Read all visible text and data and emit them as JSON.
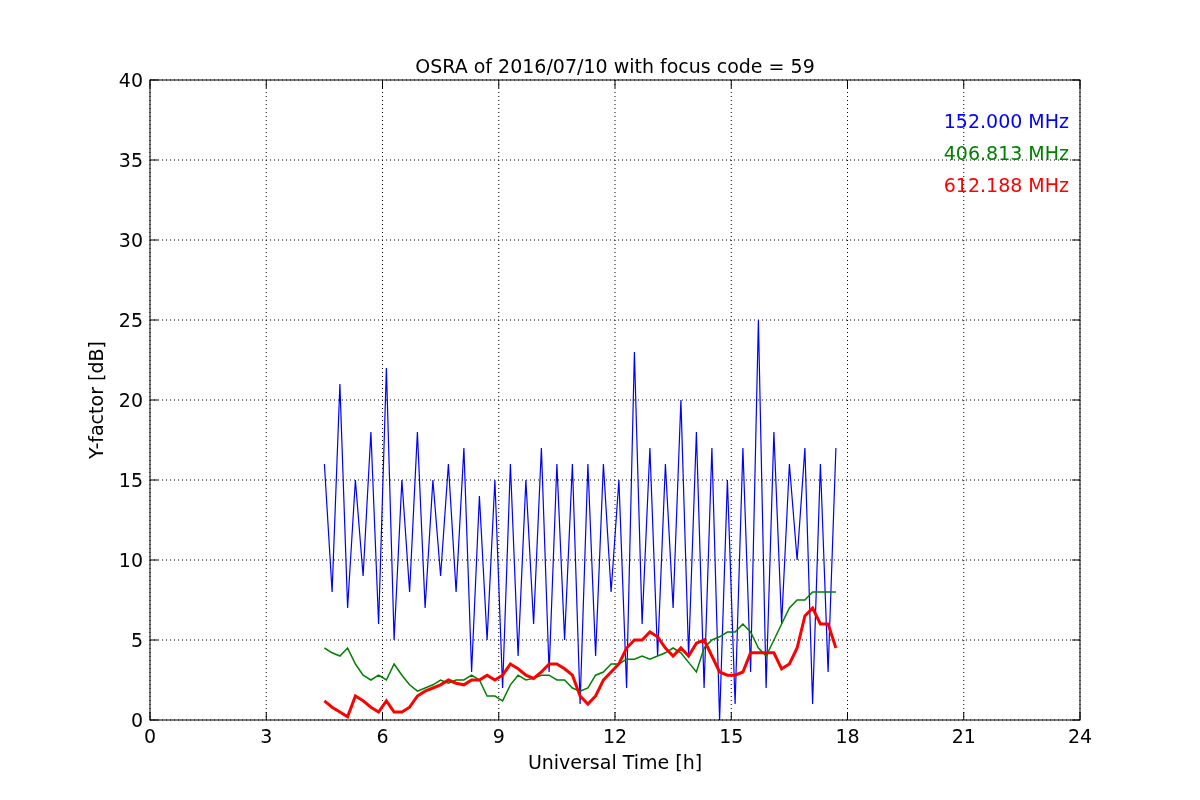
{
  "chart_data": {
    "type": "line",
    "title": "OSRA of 2016/07/10 with focus code = 59",
    "xlabel": "Universal Time [h]",
    "ylabel": "Y-factor [dB]",
    "x": [
      4.5,
      4.7,
      4.9,
      5.1,
      5.3,
      5.5,
      5.7,
      5.9,
      6.1,
      6.3,
      6.5,
      6.7,
      6.9,
      7.1,
      7.3,
      7.5,
      7.7,
      7.9,
      8.1,
      8.3,
      8.5,
      8.7,
      8.9,
      9.1,
      9.3,
      9.5,
      9.7,
      9.9,
      10.1,
      10.3,
      10.5,
      10.7,
      10.9,
      11.1,
      11.3,
      11.5,
      11.7,
      11.9,
      12.1,
      12.3,
      12.5,
      12.7,
      12.9,
      13.1,
      13.3,
      13.5,
      13.7,
      13.9,
      14.1,
      14.3,
      14.5,
      14.7,
      14.9,
      15.1,
      15.3,
      15.5,
      15.7,
      15.9,
      16.1,
      16.3,
      16.5,
      16.7,
      16.9,
      17.1,
      17.3,
      17.5,
      17.7
    ],
    "series": [
      {
        "name": "152.000 MHz",
        "color": "#0000ff",
        "values": [
          16,
          8,
          21,
          7,
          15,
          9,
          18,
          6,
          22,
          5,
          15,
          8,
          18,
          7,
          15,
          9,
          16,
          8,
          17,
          3,
          14,
          5,
          15,
          2,
          16,
          4,
          15,
          6,
          17,
          3,
          16,
          5,
          16,
          1,
          16,
          4,
          16,
          8,
          15,
          2,
          23,
          6,
          17,
          4,
          16,
          7,
          20,
          4,
          18,
          2,
          17,
          0,
          15,
          1,
          17,
          3,
          25,
          2,
          18,
          6,
          16,
          10,
          17,
          1,
          16,
          3,
          17
        ]
      },
      {
        "name": "406.813 MHz",
        "color": "#008000",
        "values": [
          4.5,
          4.2,
          4.0,
          4.5,
          3.5,
          2.8,
          2.5,
          2.8,
          2.5,
          3.5,
          2.8,
          2.2,
          1.8,
          2.0,
          2.2,
          2.5,
          2.3,
          2.5,
          2.5,
          2.8,
          2.5,
          1.5,
          1.5,
          1.2,
          2.2,
          2.8,
          2.5,
          2.6,
          2.8,
          2.8,
          2.5,
          2.5,
          2.0,
          1.8,
          2.0,
          2.8,
          3.0,
          3.5,
          3.5,
          3.8,
          3.8,
          4.0,
          3.8,
          4.0,
          4.2,
          4.5,
          4.2,
          3.6,
          3.0,
          4.5,
          5.0,
          5.2,
          5.5,
          5.5,
          6.0,
          5.5,
          4.5,
          4.0,
          5.0,
          6.0,
          7.0,
          7.5,
          7.5,
          8.0,
          8.0,
          8.0,
          8.0
        ]
      },
      {
        "name": "612.188 MHz",
        "color": "#ff0000",
        "values": [
          1.2,
          0.8,
          0.5,
          0.2,
          1.5,
          1.2,
          0.8,
          0.5,
          1.2,
          0.5,
          0.5,
          0.8,
          1.5,
          1.8,
          2.0,
          2.2,
          2.5,
          2.3,
          2.2,
          2.5,
          2.5,
          2.8,
          2.5,
          2.8,
          3.5,
          3.2,
          2.8,
          2.6,
          3.0,
          3.5,
          3.5,
          3.2,
          2.8,
          1.5,
          1.0,
          1.5,
          2.5,
          3.0,
          3.5,
          4.5,
          5.0,
          5.0,
          5.5,
          5.2,
          4.5,
          4.0,
          4.5,
          4.0,
          4.8,
          5.0,
          4.0,
          3.0,
          2.8,
          2.8,
          3.0,
          4.2,
          4.2,
          4.2,
          4.2,
          3.2,
          3.5,
          4.5,
          6.5,
          7.0,
          6.0,
          6.0,
          4.5
        ]
      }
    ],
    "grid": true,
    "xlim": [
      0,
      24
    ],
    "ylim": [
      0,
      40
    ],
    "xticks": [
      0,
      3,
      6,
      9,
      12,
      15,
      18,
      21,
      24
    ],
    "yticks": [
      0,
      5,
      10,
      15,
      20,
      25,
      30,
      35,
      40
    ]
  }
}
